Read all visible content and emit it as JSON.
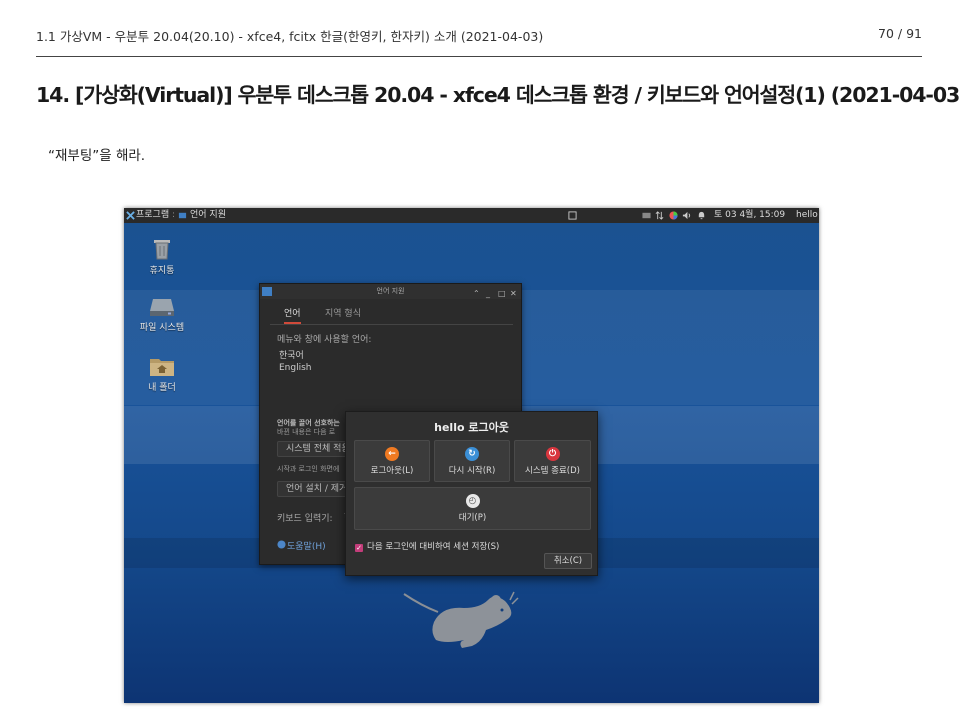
{
  "document": {
    "running_title": "1.1 가상VM - 우분투 20.04(20.10) - xfce4, fcitx 한글(한영키, 한자키) 소개 (2021-04-03)",
    "page_number": "70 / 91",
    "section_title": "14. [가상화(Virtual)] 우분투 데스크톱 20.04 - xfce4 데스크톱 환경 / 키보드와 언어설정(1) (2021-04-03)",
    "body_text": "“재부팅”을 해라."
  },
  "screenshot": {
    "panel": {
      "apps_menu": "프로그램",
      "task_language": "언어 지원",
      "clock": "토 03  4월, 15:09",
      "user": "hello"
    },
    "desktop_icons": [
      {
        "label": "휴지통",
        "icon": "trash-icon"
      },
      {
        "label": "파일 시스템",
        "icon": "drive-icon"
      },
      {
        "label": "내 폴더",
        "icon": "home-folder-icon"
      }
    ],
    "language_window": {
      "title": "언어 지원",
      "tabs": [
        "언어",
        "지역 형식"
      ],
      "menu_language_label": "메뉴와 창에 사용할 언어:",
      "languages": [
        "한국어",
        "English"
      ],
      "drag_hint_1": "언어를 끌어 선호하는",
      "drag_hint_2": "바뀐 내용은 다음 로",
      "apply_system_button": "시스템 전체 적용",
      "login_screen_note": "시작과 로그인 화면에",
      "install_remove_button": "언어 설치 / 제거",
      "keyboard_input_label": "키보드 입력기:",
      "help_button": "도움말(H)"
    },
    "logout_dialog": {
      "title": "hello 로그아웃",
      "logout_button": "로그아웃(L)",
      "restart_button": "다시 시작(R)",
      "shutdown_button": "시스템 종료(D)",
      "suspend_button": "대기(P)",
      "save_session_label": "다음 로그인에 대비하여 세션 저장(S)",
      "save_session_checked": true,
      "cancel_button": "취소(C)"
    },
    "colors": {
      "logout_icon": "#f07a22",
      "restart_icon": "#3b8fd6",
      "shutdown_icon": "#d9363e",
      "checkbox": "#c33d7a"
    }
  }
}
